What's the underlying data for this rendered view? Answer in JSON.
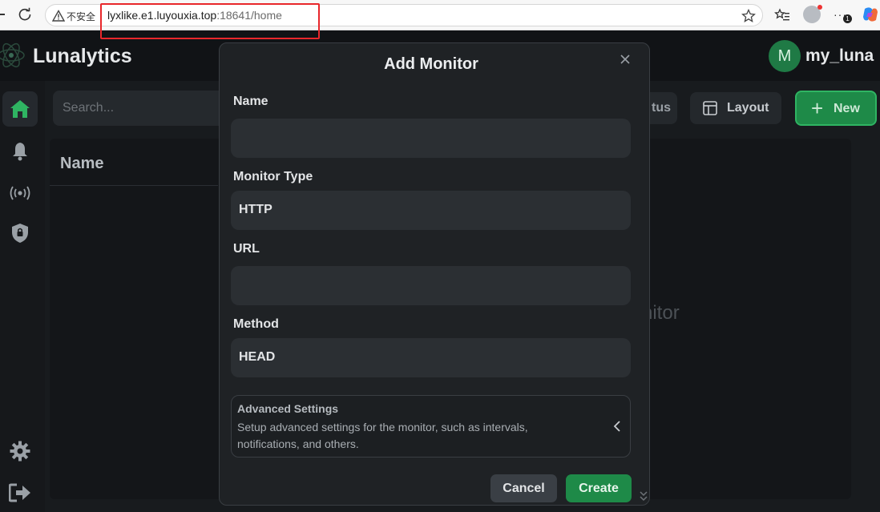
{
  "browser": {
    "security_label": "不安全",
    "url_host": "lyxlike.e1.luyouxia.top",
    "url_rest": ":18641/home",
    "extensions_badge": "1"
  },
  "app": {
    "brand": "Lunalytics",
    "user_initial": "M",
    "username": "my_luna"
  },
  "sidebar": {
    "items": [
      {
        "icon": "home-icon",
        "active": true
      },
      {
        "icon": "bell-icon"
      },
      {
        "icon": "broadcast-icon"
      },
      {
        "icon": "shield-icon"
      },
      {
        "icon": "gear-icon"
      },
      {
        "icon": "logout-icon"
      }
    ]
  },
  "toolbar": {
    "search_placeholder": "Search...",
    "status_label": "tus",
    "layout_label": "Layout",
    "new_label": "New"
  },
  "table": {
    "column_name": "Name",
    "empty_text": "nitor"
  },
  "modal": {
    "title": "Add Monitor",
    "name_label": "Name",
    "name_value": "",
    "type_label": "Monitor Type",
    "type_value": "HTTP",
    "url_label": "URL",
    "url_value": "",
    "method_label": "Method",
    "method_value": "HEAD",
    "advanced_title": "Advanced Settings",
    "advanced_desc": "Setup advanced settings for the monitor, such as intervals, notifications, and others.",
    "cancel_label": "Cancel",
    "create_label": "Create"
  },
  "colors": {
    "accent_green": "#1e8a48",
    "annotation_red": "#e8272b"
  }
}
